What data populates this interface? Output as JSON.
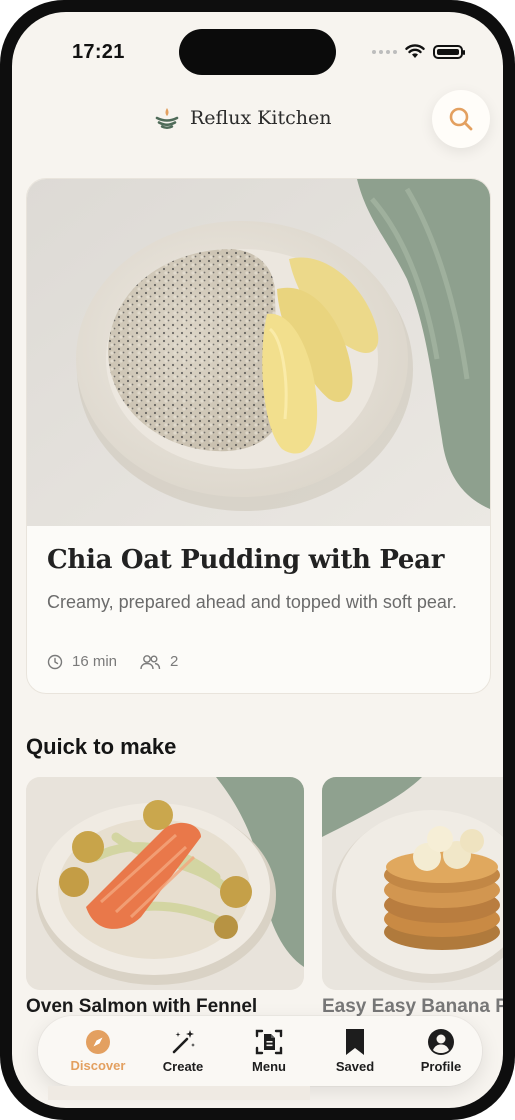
{
  "status_bar": {
    "time": "17:21"
  },
  "header": {
    "app_name": "Reflux Kitchen"
  },
  "hero": {
    "title": "Chia Oat Pudding with Pear",
    "description": "Creamy, prepared ahead and topped with soft pear.",
    "time": "16 min",
    "servings": "2"
  },
  "quick_section": {
    "title": "Quick to make",
    "cards": [
      {
        "title": "Oven Salmon with Fennel"
      },
      {
        "title": "Easy Easy Banana Pancakes"
      }
    ]
  },
  "tabs": [
    {
      "label": "Discover",
      "icon": "compass-icon",
      "active": true
    },
    {
      "label": "Create",
      "icon": "magic-wand-icon"
    },
    {
      "label": "Menu",
      "icon": "document-scan-icon"
    },
    {
      "label": "Saved",
      "icon": "bookmark-icon"
    },
    {
      "label": "Profile",
      "icon": "profile-icon"
    }
  ],
  "colors": {
    "accent": "#e3a060",
    "background": "#f7f4ef",
    "card": "#fcfbf8"
  }
}
